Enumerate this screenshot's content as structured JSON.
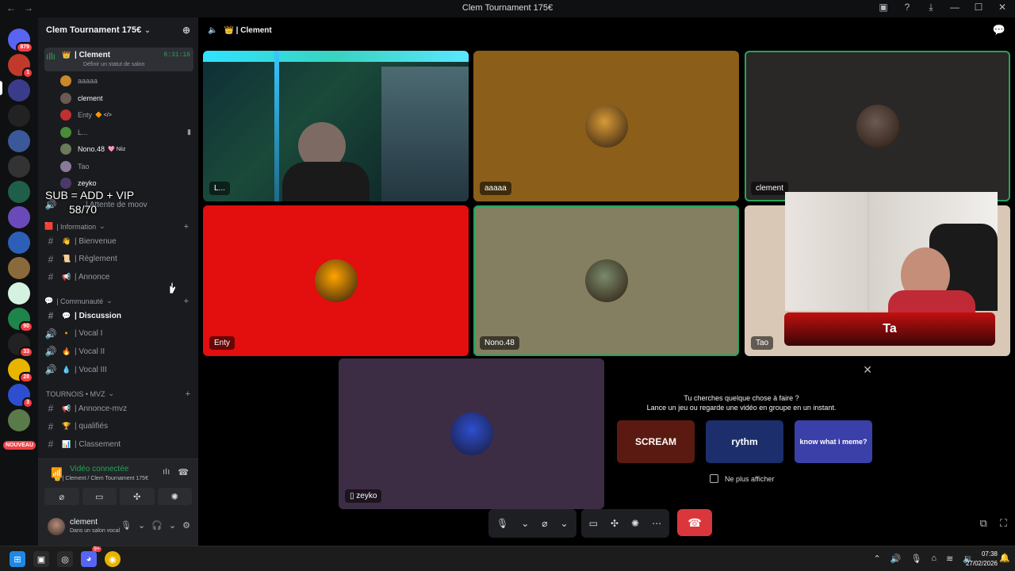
{
  "titlebar": {
    "title": "Clem Tournament 175€",
    "back": "←",
    "forward": "→"
  },
  "servers": [
    {
      "icon": "discord-icon",
      "badge": "879",
      "color": "#5865f2"
    },
    {
      "icon": "red-server",
      "badge": "1",
      "color": "#c0392b"
    },
    {
      "icon": "folder-icon",
      "badge": "",
      "color": "#3a3c8a"
    },
    {
      "icon": "starea",
      "badge": "",
      "color": "#222"
    },
    {
      "icon": "game-server",
      "badge": "",
      "color": "#3b5998"
    },
    {
      "icon": "dark-server",
      "badge": "",
      "color": "#333"
    },
    {
      "icon": "green-server",
      "badge": "",
      "color": "#1f5f4a"
    },
    {
      "icon": "purple-server",
      "badge": "",
      "color": "#6a4ab8"
    },
    {
      "icon": "src-server",
      "badge": "",
      "color": "#2e5fb8"
    },
    {
      "icon": "face-server",
      "badge": "",
      "color": "#8a6a3a"
    },
    {
      "icon": "cup-server",
      "badge": "",
      "color": "#d5f2e0"
    },
    {
      "icon": "green-stripe-server",
      "badge": "90",
      "color": "#1e8449"
    },
    {
      "icon": "h-server",
      "badge": "33",
      "color": "#222"
    },
    {
      "icon": "yellow-server",
      "badge": "28",
      "color": "#e8b400"
    },
    {
      "icon": "flag-server",
      "badge": "3",
      "color": "#2d4fcf"
    },
    {
      "icon": "nature-server",
      "badge": "",
      "color": "#5a7a4a"
    }
  ],
  "new_label": "NOUVEAU",
  "guild": {
    "name": "Clem Tournament 175€",
    "chevron": "⌄",
    "invite_icon": "add-member-icon"
  },
  "voice_channel": {
    "emoji": "👑",
    "name": "| Clement",
    "timer": "8:31:16",
    "status_hint": "Définir un statut de salon",
    "users": [
      {
        "name": "aaaaa",
        "tag": "",
        "bold": false,
        "color": "#c9882a"
      },
      {
        "name": "clement",
        "tag": "",
        "bold": true,
        "color": "#6b5a52"
      },
      {
        "name": "Enty",
        "tag": "🔶 </>",
        "bold": false,
        "color": "#c03030"
      },
      {
        "name": "L...",
        "tag": "",
        "bold": false,
        "color": "#4a8a3a"
      },
      {
        "name": "Nono.48",
        "tag": "🩷 Niiz",
        "bold": true,
        "color": "#6a7a5a"
      },
      {
        "name": "Tao",
        "tag": "",
        "bold": false,
        "color": "#8a7a9a"
      },
      {
        "name": "zeyko",
        "tag": "",
        "bold": true,
        "color": "#4a3a6a"
      }
    ],
    "hidden_channel": "| Attente de moov"
  },
  "overlay": {
    "line1": "SUB = ADD + VIP",
    "line2": "58/70"
  },
  "categories": [
    {
      "name": "| Information",
      "emoji": "🟥",
      "channels": [
        {
          "type": "text",
          "emoji": "👋",
          "name": "| Bienvenue",
          "bold": false
        },
        {
          "type": "text",
          "emoji": "📜",
          "name": "| Règlement",
          "bold": false
        },
        {
          "type": "text",
          "emoji": "📢",
          "name": "| Annonce",
          "bold": false
        }
      ]
    },
    {
      "name": "| Communauté",
      "emoji": "💬",
      "channels": [
        {
          "type": "text",
          "emoji": "💬",
          "name": "| Discussion",
          "bold": true
        },
        {
          "type": "voice",
          "emoji": "🔸",
          "name": "| Vocal I",
          "bold": false
        },
        {
          "type": "voice",
          "emoji": "🔥",
          "name": "| Vocal II",
          "bold": false
        },
        {
          "type": "voice",
          "emoji": "💧",
          "name": "| Vocal III",
          "bold": false
        }
      ]
    },
    {
      "name": "TOURNOIS • MVZ",
      "emoji": "",
      "channels": [
        {
          "type": "text",
          "emoji": "📢",
          "name": "| Annonce-mvz",
          "bold": false
        },
        {
          "type": "text",
          "emoji": "🏆",
          "name": "| qualifiés",
          "bold": false
        },
        {
          "type": "text",
          "emoji": "📊",
          "name": "| Classement",
          "bold": false
        }
      ]
    }
  ],
  "voice_panel": {
    "status": "Vidéo connectée",
    "location": "👑 | Clement / Clem Tournament 175€"
  },
  "user_panel": {
    "name": "clement",
    "status": "Dans un salon vocal"
  },
  "call": {
    "header_name": "👑 | Clement",
    "tiles": [
      {
        "label": "L...",
        "kind": "video-room",
        "speaking": false
      },
      {
        "label": "aaaaa",
        "kind": "avatar",
        "bg": "#8b5f1a",
        "avatar": "#d89a36",
        "speaking": false
      },
      {
        "label": "clement",
        "kind": "avatar",
        "bg": "#2a2727",
        "avatar": "#6b5a52",
        "speaking": true
      },
      {
        "label": "Enty",
        "kind": "avatar",
        "bg": "#e30e0e",
        "avatar": "#ffa400",
        "speaking": false
      },
      {
        "label": "Nono.48",
        "kind": "avatar",
        "bg": "#857f62",
        "avatar": "#7a8a6a",
        "speaking": true
      },
      {
        "label": "Tao",
        "kind": "avatar",
        "bg": "#d8c8b5",
        "avatar": "#8a7a9a",
        "speaking": false
      }
    ],
    "featured": {
      "label": "zeyko",
      "bg": "#3c2d45",
      "avatar": "#2d4fcf"
    },
    "webcam_name": "Ta"
  },
  "promo": {
    "question": "Tu cherches quelque chose à faire ?",
    "subtitle": "Lance un jeu ou regarde une vidéo en groupe en un instant.",
    "cards": [
      {
        "label": "SCREAM",
        "bg": "#5a1a12"
      },
      {
        "label": "rythm",
        "bg": "#1c2e6b"
      },
      {
        "label": "know what i meme?",
        "bg": "#3b3fa8"
      }
    ],
    "dont_show": "Ne plus afficher"
  },
  "taskbar": {
    "time": "07:38",
    "date": "27/02/2026",
    "discord_badge": "9+"
  }
}
